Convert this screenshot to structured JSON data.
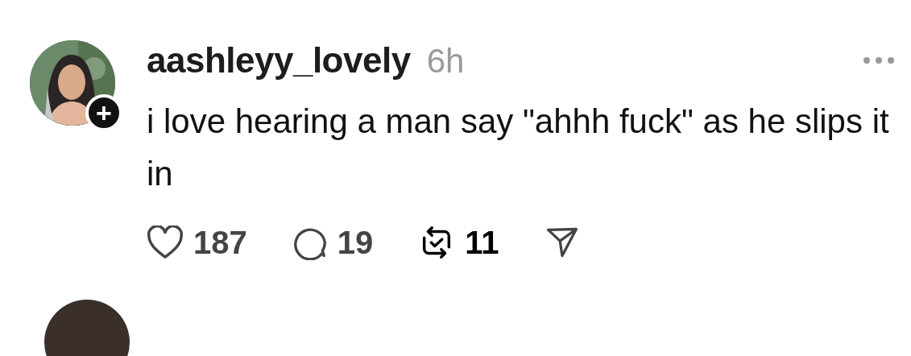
{
  "post": {
    "username": "aashleyy_lovely",
    "time": "6h",
    "text": "i love hearing a man say \"ahhh fuck\" as he slips it in",
    "follow_badge": "+",
    "actions": [
      {
        "kind": "like",
        "count": "187",
        "selected": false
      },
      {
        "kind": "reply",
        "count": "19",
        "selected": false
      },
      {
        "kind": "repost",
        "count": "11",
        "selected": true
      },
      {
        "kind": "share",
        "selected": false
      }
    ]
  }
}
